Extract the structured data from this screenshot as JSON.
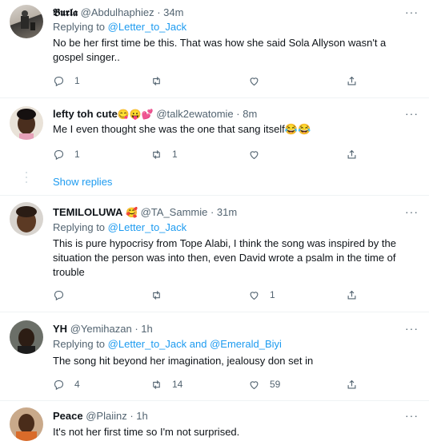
{
  "tweets": [
    {
      "name": "𝕭𝖚𝖗𝖑𝖆",
      "handle": "@Abdulhaphiez",
      "time": "· 34m",
      "replying_label": "Replying to",
      "replying_to": "@Letter_to_Jack",
      "text": "No be her first time be this. That was how she said Sola Allyson wasn't a gospel singer..",
      "reply_count": "1",
      "retweet_count": "",
      "like_count": ""
    },
    {
      "name": "lefty toh cute",
      "name_emoji": "😋😛💕",
      "handle": "@talk2ewatomie",
      "time": "· 8m",
      "text": "Me I even thought she was the one that sang itself😂😂",
      "reply_count": "1",
      "retweet_count": "1",
      "like_count": ""
    },
    {
      "name": "TEMILOLUWA",
      "name_emoji": "🥰",
      "handle": "@TA_Sammie",
      "time": "· 31m",
      "replying_label": "Replying to",
      "replying_to": "@Letter_to_Jack",
      "text": "This is pure hypocrisy from Tope Alabi, I think the song was inspired by the situation the person was into then, even David wrote a psalm in the time of trouble",
      "reply_count": "",
      "retweet_count": "",
      "like_count": "1"
    },
    {
      "name": "YH",
      "handle": "@Yemihazan",
      "time": "· 1h",
      "replying_label": "Replying to",
      "replying_to": "@Letter_to_Jack",
      "replying_and": "and",
      "replying_to_2": "@Emerald_Biyi",
      "text": "The song hit beyond her imagination,  jealousy don set in",
      "reply_count": "4",
      "retweet_count": "14",
      "like_count": "59"
    },
    {
      "name": "Peace",
      "handle": "@Plaiinz",
      "time": "· 1h",
      "text": "It's not her first time so I'm not surprised."
    }
  ],
  "show_replies": "Show replies",
  "more_glyph": "···",
  "icons": [
    "reply-icon",
    "retweet-icon",
    "like-icon",
    "share-icon",
    "more-icon"
  ]
}
